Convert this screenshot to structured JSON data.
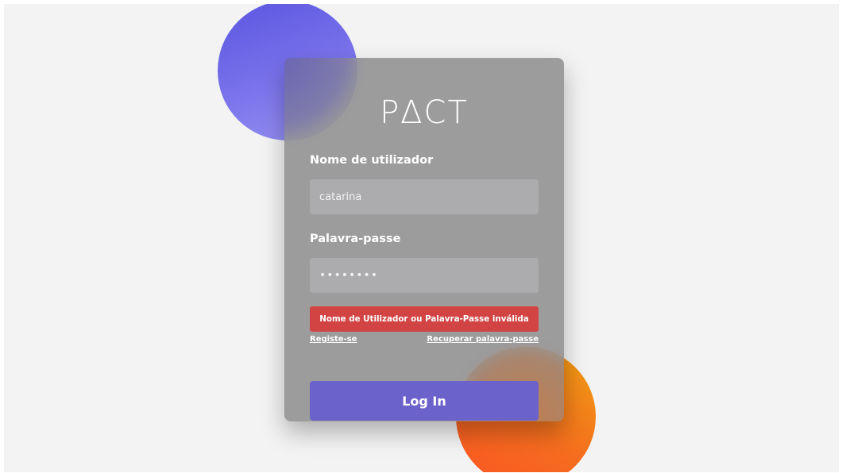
{
  "brand": {
    "logo_text": "PΔCT"
  },
  "login_form": {
    "username_label": "Nome de utilizador",
    "username_value": "catarina",
    "password_label": "Palavra-passe",
    "password_value": "••••••••",
    "error_message": "Nome de Utilizador ou Palavra-Passe inválida",
    "register_link": "Registe-se",
    "recover_link": "Recuperar palavra-passe",
    "login_button": "Log In"
  },
  "colors": {
    "accent": "#6c62cc",
    "error": "#d24444",
    "blob_purple": "#5b55e0",
    "blob_orange": "#f56d1e",
    "background": "#f3f3f3"
  }
}
